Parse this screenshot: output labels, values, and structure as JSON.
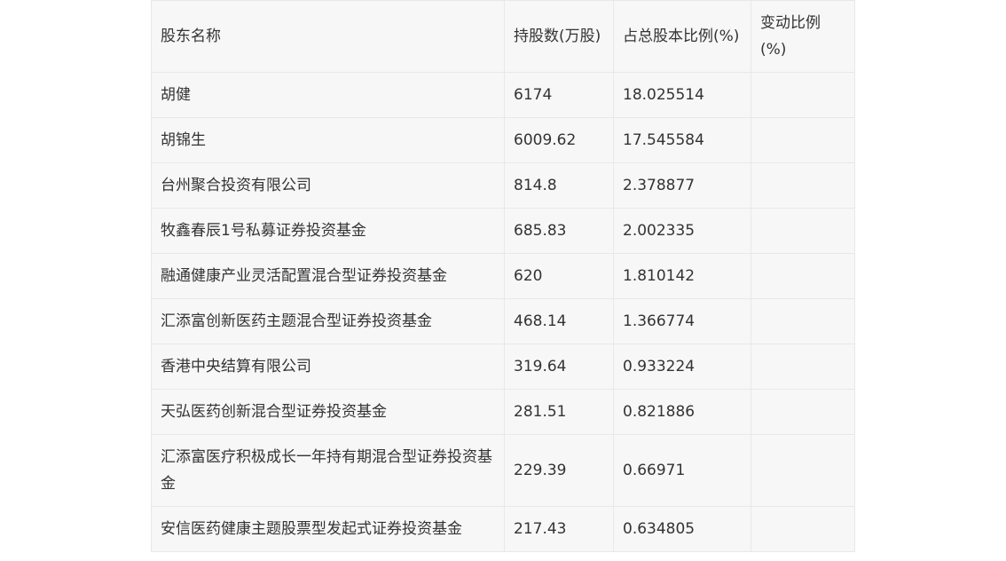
{
  "table": {
    "headers": [
      "股东名称",
      "持股数(万股)",
      "占总股本比例(%)",
      "变动比例(%)"
    ],
    "rows": [
      [
        "胡健",
        "6174",
        "18.025514",
        ""
      ],
      [
        "胡锦生",
        "6009.62",
        "17.545584",
        ""
      ],
      [
        "台州聚合投资有限公司",
        "814.8",
        "2.378877",
        ""
      ],
      [
        "牧鑫春辰1号私募证券投资基金",
        "685.83",
        "2.002335",
        ""
      ],
      [
        "融通健康产业灵活配置混合型证券投资基金",
        "620",
        "1.810142",
        ""
      ],
      [
        "汇添富创新医药主题混合型证券投资基金",
        "468.14",
        "1.366774",
        ""
      ],
      [
        "香港中央结算有限公司",
        "319.64",
        "0.933224",
        ""
      ],
      [
        "天弘医药创新混合型证券投资基金",
        "281.51",
        "0.821886",
        ""
      ],
      [
        "汇添富医疗积极成长一年持有期混合型证券投资基金",
        "229.39",
        "0.66971",
        ""
      ],
      [
        "安信医药健康主题股票型发起式证券投资基金",
        "217.43",
        "0.634805",
        ""
      ]
    ]
  }
}
